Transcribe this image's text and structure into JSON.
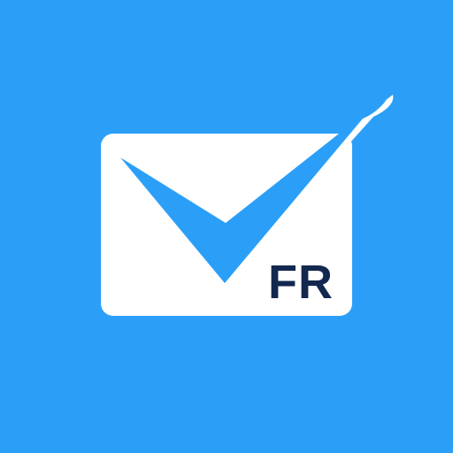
{
  "app_icon": {
    "name": "mail-check-icon",
    "badge_text": "FR"
  },
  "colors": {
    "background": "#2b9ff8",
    "envelope": "#ffffff",
    "checkmark": "#2b9ff8",
    "badge_text": "#13284f"
  }
}
